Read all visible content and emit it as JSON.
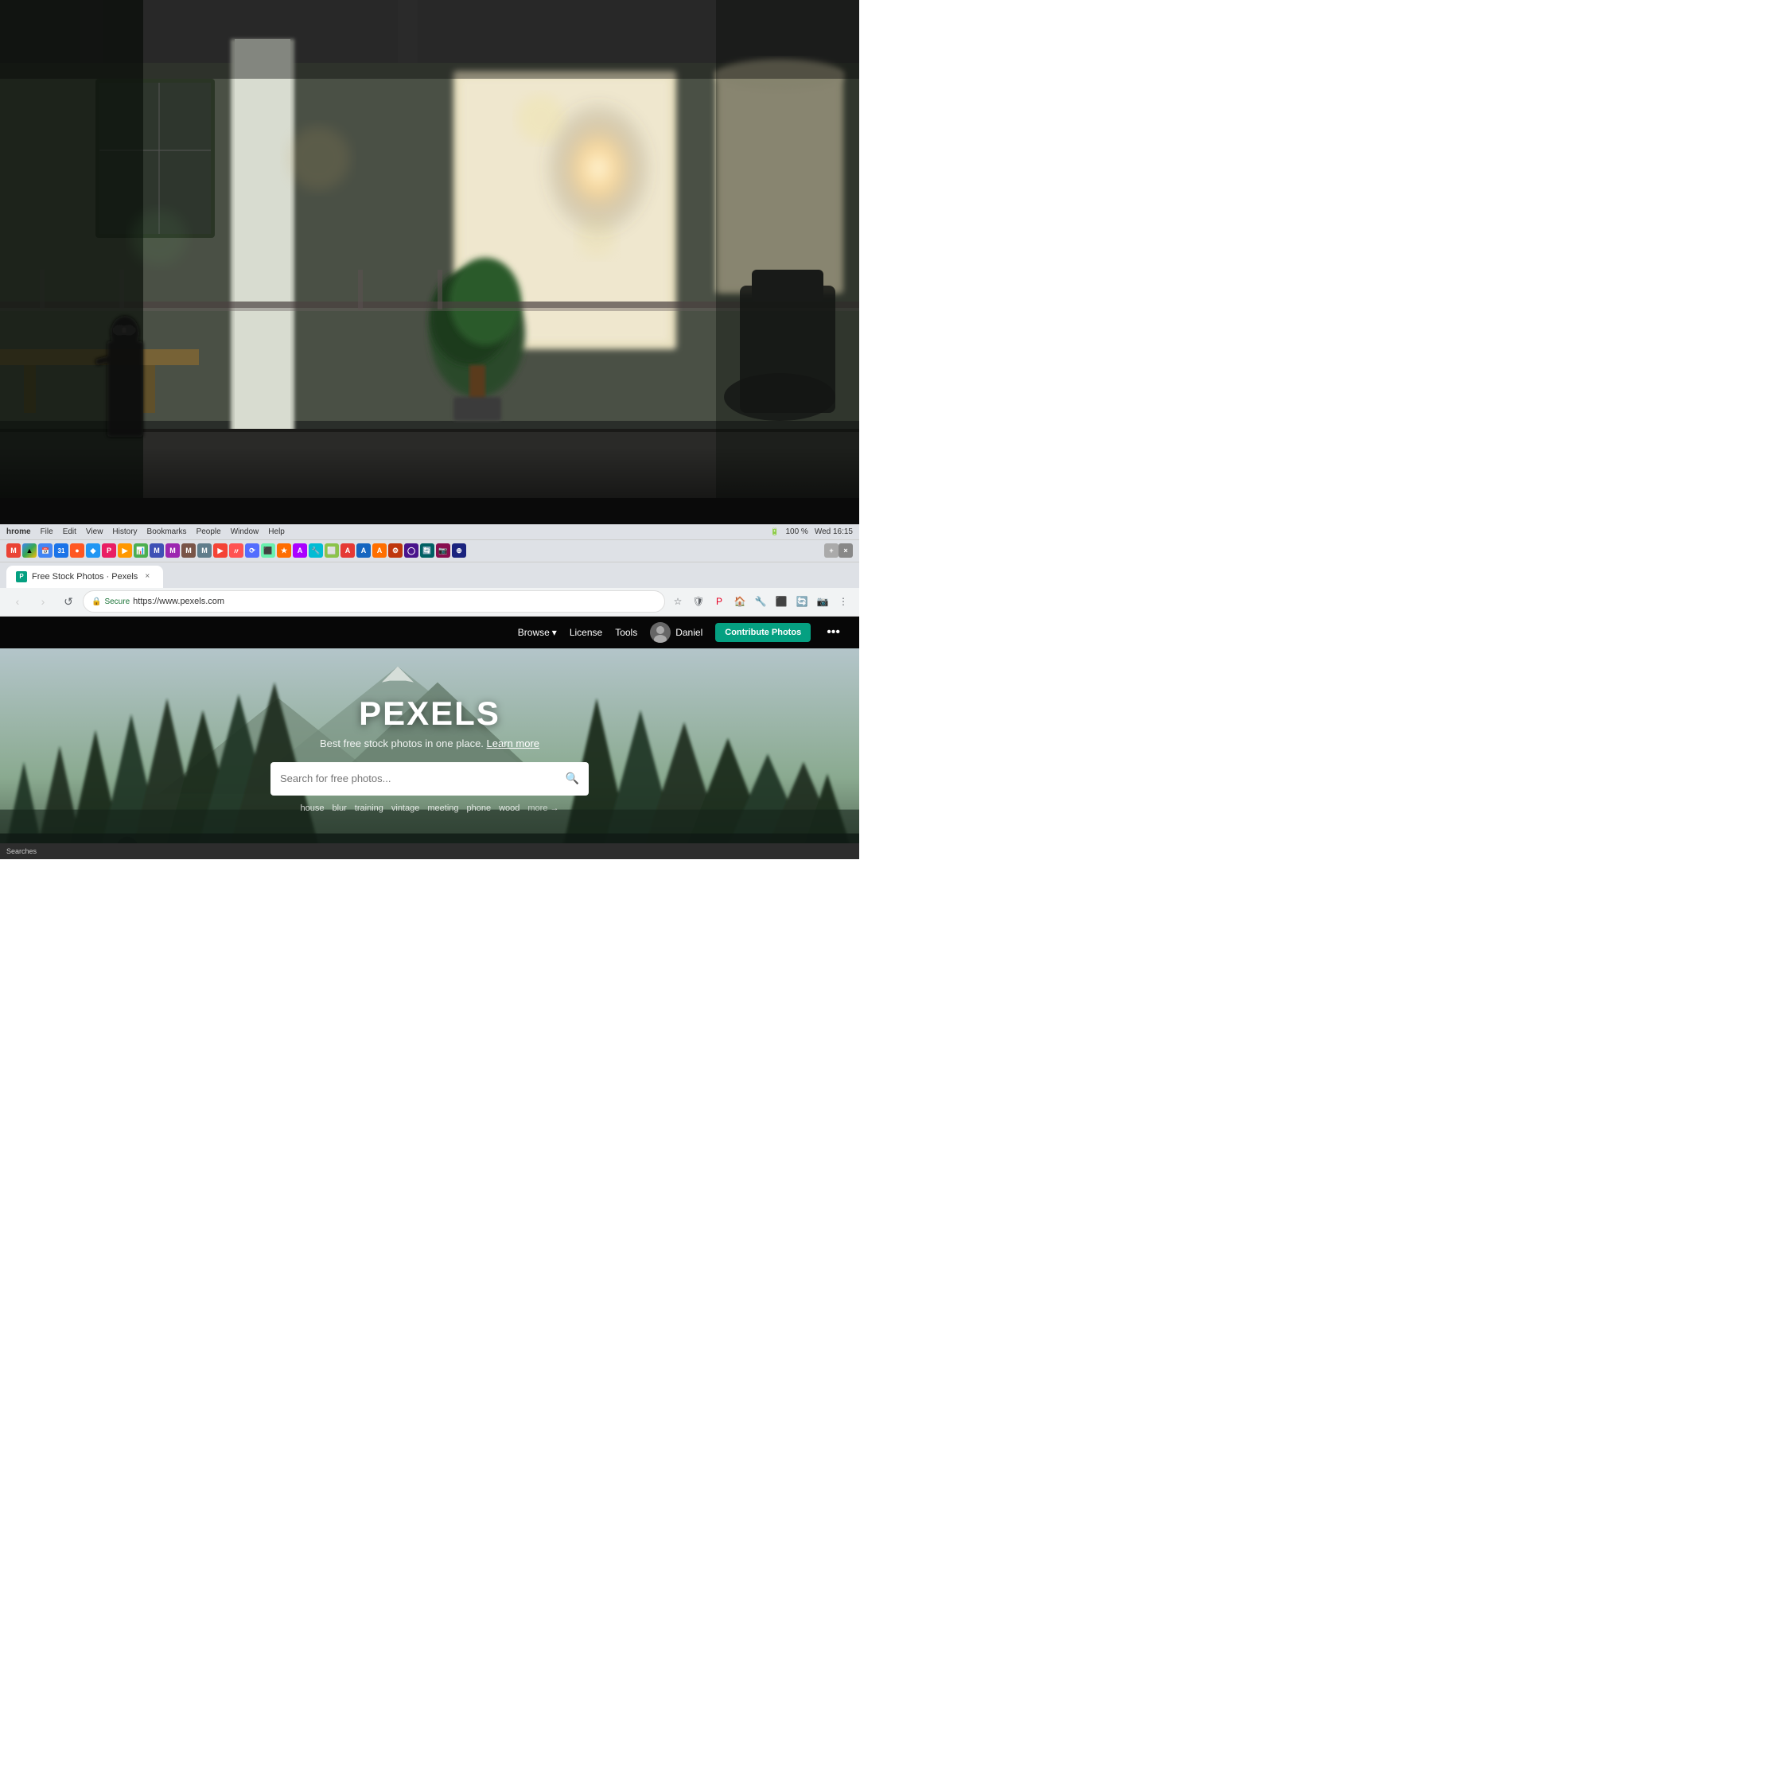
{
  "photo": {
    "description": "Office background photo - blurry modern office with plants and windows"
  },
  "browser": {
    "os_menu": {
      "app_name": "hrome",
      "items": [
        "File",
        "Edit",
        "View",
        "History",
        "Bookmarks",
        "People",
        "Window",
        "Help"
      ],
      "right_items": [
        "100 %",
        "Wed 16:15"
      ]
    },
    "tab": {
      "favicon_text": "P",
      "title": "Free Stock Photos · Pexels",
      "close_label": "×"
    },
    "address_bar": {
      "secure_label": "Secure",
      "url": "https://www.pexels.com",
      "back_icon": "‹",
      "forward_icon": "›",
      "refresh_icon": "↺"
    }
  },
  "pexels": {
    "nav": {
      "browse_label": "Browse",
      "license_label": "License",
      "tools_label": "Tools",
      "user_name": "Daniel",
      "contribute_label": "Contribute Photos",
      "more_icon": "•••"
    },
    "hero": {
      "title": "PEXELS",
      "subtitle": "Best free stock photos in one place.",
      "learn_more_label": "Learn more",
      "search_placeholder": "Search for free photos...",
      "tags": [
        "house",
        "blur",
        "training",
        "vintage",
        "meeting",
        "phone",
        "wood"
      ],
      "more_label": "more →"
    }
  },
  "taskbar": {
    "label": "Searches"
  }
}
